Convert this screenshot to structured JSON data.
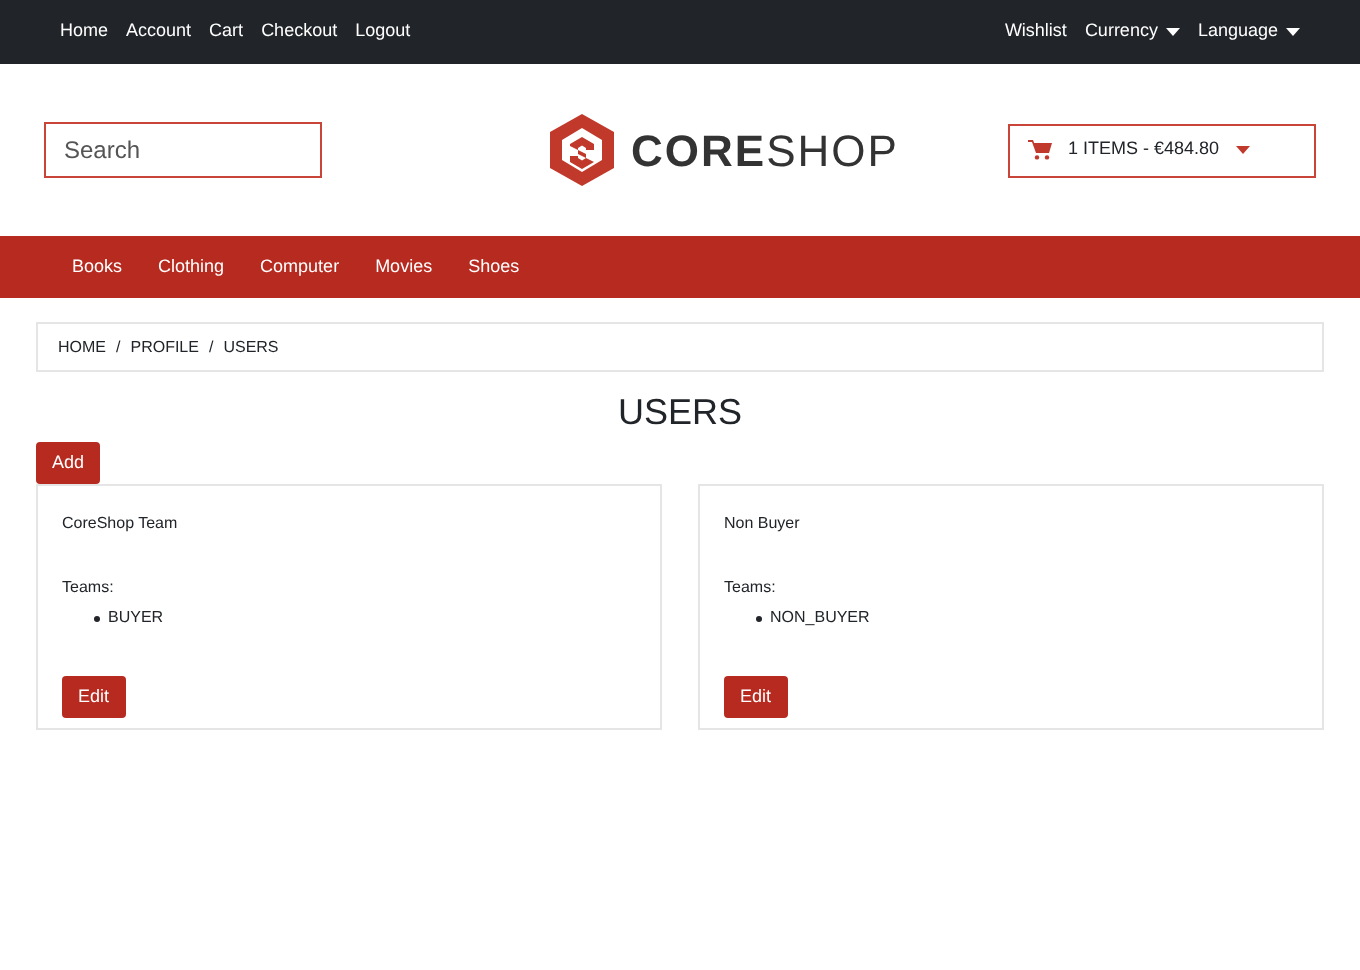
{
  "top_nav": {
    "left": [
      "Home",
      "Account",
      "Cart",
      "Checkout",
      "Logout"
    ],
    "right": [
      {
        "label": "Wishlist",
        "dropdown": false
      },
      {
        "label": "Currency",
        "dropdown": true
      },
      {
        "label": "Language",
        "dropdown": true
      }
    ]
  },
  "search": {
    "placeholder": "Search"
  },
  "logo": "**CORE**SHOP",
  "cart": {
    "label": "1 ITEMS - €484.80"
  },
  "categories": [
    "Books",
    "Clothing",
    "Computer",
    "Movies",
    "Shoes"
  ],
  "breadcrumb": [
    {
      "label": "HOME"
    },
    {
      "separator": "/",
      "label": "PROFILE"
    },
    {
      "separator": "/",
      "label": "USERS"
    }
  ],
  "title": "USERS",
  "add_button": "Add",
  "users": [
    {
      "name": "CoreShop Team",
      "teams_label": "Teams:",
      "teams": [
        "BUYER"
      ],
      "button": "Edit"
    },
    {
      "name": "Non Buyer",
      "teams_label": "Teams:",
      "teams": [
        "NON_BUYER"
      ],
      "button": "Edit"
    }
  ]
}
